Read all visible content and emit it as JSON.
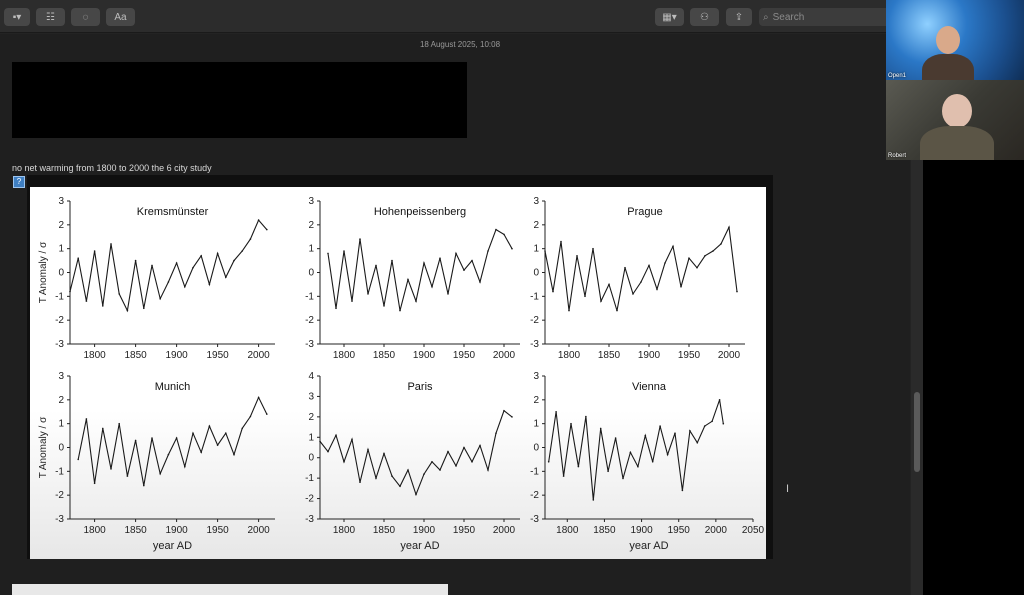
{
  "toolbar": {
    "search_placeholder": "Search",
    "font_button_label": "Aa"
  },
  "note": {
    "date": "18 August 2025, 10:08",
    "caption": "no net warming from 1800 to 2000 the 6 city study"
  },
  "video": {
    "participant_1": "Open1",
    "participant_2": "Robert"
  },
  "chart_data": [
    {
      "type": "line",
      "title": "Kremsmünster",
      "ylabel": "T Anomaly / σ",
      "xlabel": "",
      "xlim": [
        1770,
        2020
      ],
      "ylim": [
        -3,
        3
      ],
      "x_ticks": [
        "1800",
        "1850",
        "1900",
        "1950",
        "2000"
      ],
      "y_ticks": [
        "3",
        "2",
        "1",
        "0",
        "-1",
        "-2",
        "-3"
      ],
      "series": [
        {
          "x": [
            1770,
            1780,
            1790,
            1800,
            1810,
            1820,
            1830,
            1840,
            1850,
            1860,
            1870,
            1880,
            1890,
            1900,
            1910,
            1920,
            1930,
            1940,
            1950,
            1960,
            1970,
            1980,
            1990,
            2000,
            2010
          ],
          "values": [
            -0.8,
            0.6,
            -1.2,
            0.9,
            -1.4,
            1.2,
            -0.9,
            -1.6,
            0.5,
            -1.5,
            0.3,
            -1.1,
            -0.4,
            0.4,
            -0.6,
            0.2,
            0.7,
            -0.5,
            0.8,
            -0.2,
            0.5,
            0.9,
            1.4,
            2.2,
            1.8
          ]
        }
      ]
    },
    {
      "type": "line",
      "title": "Hohenpeissenberg",
      "ylabel": "",
      "xlabel": "",
      "xlim": [
        1770,
        2020
      ],
      "ylim": [
        -3,
        3
      ],
      "x_ticks": [
        "1800",
        "1850",
        "1900",
        "1950",
        "2000"
      ],
      "y_ticks": [
        "3",
        "2",
        "1",
        "0",
        "-1",
        "-2",
        "-3"
      ],
      "series": [
        {
          "x": [
            1780,
            1790,
            1800,
            1810,
            1820,
            1830,
            1840,
            1850,
            1860,
            1870,
            1880,
            1890,
            1900,
            1910,
            1920,
            1930,
            1940,
            1950,
            1960,
            1970,
            1980,
            1990,
            2000,
            2010
          ],
          "values": [
            0.8,
            -1.5,
            0.9,
            -1.2,
            1.4,
            -0.9,
            0.3,
            -1.4,
            0.5,
            -1.6,
            -0.3,
            -1.2,
            0.4,
            -0.6,
            0.6,
            -0.9,
            0.8,
            0.1,
            0.5,
            -0.4,
            0.9,
            1.8,
            1.6,
            1.0
          ]
        }
      ]
    },
    {
      "type": "line",
      "title": "Prague",
      "ylabel": "",
      "xlabel": "",
      "xlim": [
        1770,
        2020
      ],
      "ylim": [
        -3,
        3
      ],
      "x_ticks": [
        "1800",
        "1850",
        "1900",
        "1950",
        "2000"
      ],
      "y_ticks": [
        "3",
        "2",
        "1",
        "0",
        "-1",
        "-2",
        "-3"
      ],
      "series": [
        {
          "x": [
            1770,
            1780,
            1790,
            1800,
            1810,
            1820,
            1830,
            1840,
            1850,
            1860,
            1870,
            1880,
            1890,
            1900,
            1910,
            1920,
            1930,
            1940,
            1950,
            1960,
            1970,
            1980,
            1990,
            2000,
            2010
          ],
          "values": [
            0.9,
            -0.8,
            1.3,
            -1.6,
            0.7,
            -1.0,
            1.0,
            -1.2,
            -0.5,
            -1.6,
            0.2,
            -0.9,
            -0.4,
            0.3,
            -0.7,
            0.4,
            1.1,
            -0.6,
            0.6,
            0.2,
            0.7,
            0.9,
            1.2,
            1.9,
            -0.8
          ]
        }
      ]
    },
    {
      "type": "line",
      "title": "Munich",
      "ylabel": "T Anomaly / σ",
      "xlabel": "year AD",
      "xlim": [
        1770,
        2020
      ],
      "ylim": [
        -3,
        3
      ],
      "x_ticks": [
        "1800",
        "1850",
        "1900",
        "1950",
        "2000"
      ],
      "y_ticks": [
        "3",
        "2",
        "1",
        "0",
        "-1",
        "-2",
        "-3"
      ],
      "series": [
        {
          "x": [
            1780,
            1790,
            1800,
            1810,
            1820,
            1830,
            1840,
            1850,
            1860,
            1870,
            1880,
            1890,
            1900,
            1910,
            1920,
            1930,
            1940,
            1950,
            1960,
            1970,
            1980,
            1990,
            2000,
            2010
          ],
          "values": [
            -0.5,
            1.2,
            -1.5,
            0.8,
            -0.9,
            1.0,
            -1.2,
            0.3,
            -1.6,
            0.4,
            -1.1,
            -0.3,
            0.4,
            -0.8,
            0.6,
            -0.2,
            0.9,
            0.1,
            0.6,
            -0.3,
            0.8,
            1.3,
            2.1,
            1.4
          ]
        }
      ]
    },
    {
      "type": "line",
      "title": "Paris",
      "ylabel": "",
      "xlabel": "year AD",
      "xlim": [
        1770,
        2020
      ],
      "ylim": [
        -3,
        4
      ],
      "x_ticks": [
        "1800",
        "1850",
        "1900",
        "1950",
        "2000"
      ],
      "y_ticks": [
        "4",
        "3",
        "2",
        "1",
        "0",
        "-1",
        "-2",
        "-3"
      ],
      "series": [
        {
          "x": [
            1770,
            1780,
            1790,
            1800,
            1810,
            1820,
            1830,
            1840,
            1850,
            1860,
            1870,
            1880,
            1890,
            1900,
            1910,
            1920,
            1930,
            1940,
            1950,
            1960,
            1970,
            1980,
            1990,
            2000,
            2010
          ],
          "values": [
            0.8,
            0.3,
            1.1,
            -0.2,
            0.9,
            -1.2,
            0.4,
            -1.0,
            0.2,
            -0.9,
            -1.4,
            -0.6,
            -1.8,
            -0.8,
            -0.2,
            -0.6,
            0.3,
            -0.4,
            0.5,
            -0.2,
            0.6,
            -0.6,
            1.2,
            2.3,
            2.0
          ]
        }
      ]
    },
    {
      "type": "line",
      "title": "Vienna",
      "ylabel": "",
      "xlabel": "year AD",
      "xlim": [
        1770,
        2050
      ],
      "ylim": [
        -3,
        3
      ],
      "x_ticks": [
        "1800",
        "1850",
        "1900",
        "1950",
        "2000",
        "2050"
      ],
      "y_ticks": [
        "3",
        "2",
        "1",
        "0",
        "-1",
        "-2",
        "-3"
      ],
      "series": [
        {
          "x": [
            1775,
            1785,
            1795,
            1805,
            1815,
            1825,
            1835,
            1845,
            1855,
            1865,
            1875,
            1885,
            1895,
            1905,
            1915,
            1925,
            1935,
            1945,
            1955,
            1965,
            1975,
            1985,
            1995,
            2005,
            2010
          ],
          "values": [
            -0.6,
            1.5,
            -1.2,
            1.0,
            -0.8,
            1.3,
            -2.2,
            0.8,
            -1.0,
            0.4,
            -1.3,
            -0.2,
            -0.8,
            0.5,
            -0.6,
            0.9,
            -0.3,
            0.6,
            -1.8,
            0.7,
            0.2,
            0.9,
            1.1,
            2.0,
            1.0
          ]
        }
      ]
    }
  ]
}
